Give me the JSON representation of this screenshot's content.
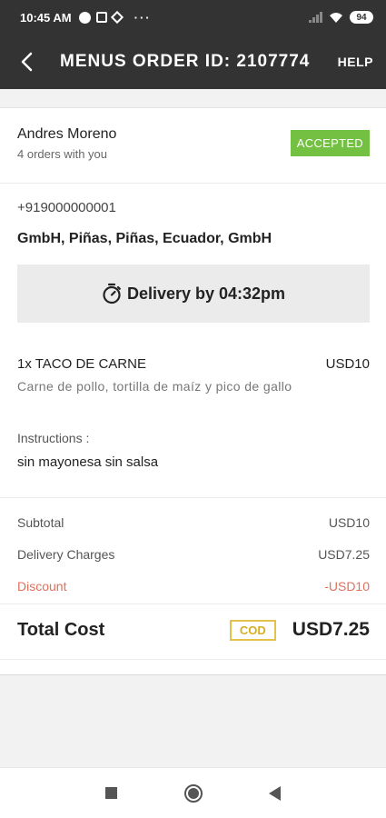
{
  "status_bar": {
    "time": "10:45 AM",
    "battery": "94"
  },
  "app_bar": {
    "title": "MENUS ORDER ID: 2107774",
    "help_label": "HELP"
  },
  "customer": {
    "name": "Andres Moreno",
    "orders_text": "4 orders with you",
    "status": "ACCEPTED"
  },
  "contact": {
    "phone": "+919000000001",
    "address": "GmbH, Piñas, Piñas, Ecuador, GmbH"
  },
  "delivery": {
    "text": "Delivery by 04:32pm"
  },
  "item": {
    "title": "1x TACO DE CARNE",
    "price": "USD10",
    "description": "Carne de pollo, tortilla de maíz y pico de gallo",
    "instructions_label": "Instructions :",
    "instructions": "sin mayonesa sin salsa"
  },
  "summary": {
    "subtotal_label": "Subtotal",
    "subtotal_value": "USD10",
    "delivery_label": "Delivery Charges",
    "delivery_value": "USD7.25",
    "discount_label": "Discount",
    "discount_value": "-USD10",
    "total_label": "Total Cost",
    "payment_method": "COD",
    "total_value": "USD7.25"
  },
  "colors": {
    "header": "#333333",
    "accepted": "#74c043",
    "discount": "#e0705c",
    "cod": "#d7ae23"
  }
}
